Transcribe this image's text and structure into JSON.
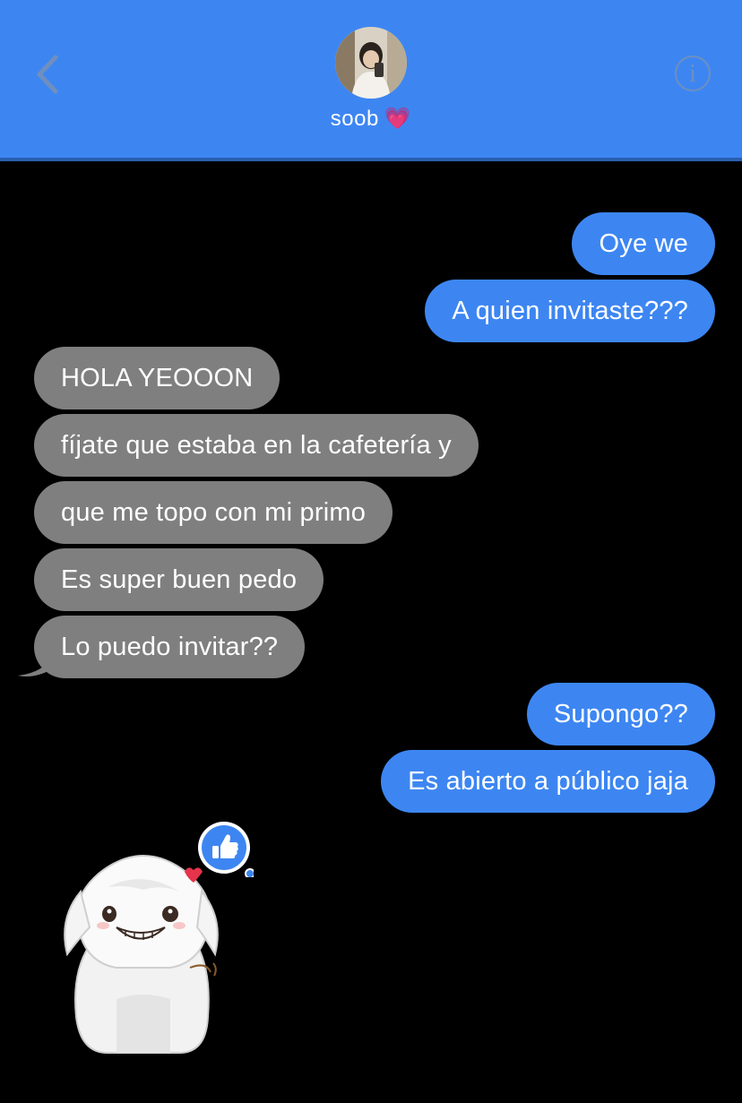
{
  "header": {
    "contact_name": "soob",
    "name_emoji": "💗",
    "info_glyph": "i",
    "back_icon": "chevron-left-icon",
    "info_icon": "info-icon"
  },
  "colors": {
    "header_bg": "#3d86f2",
    "outgoing_bubble": "#3d86f2",
    "incoming_bubble": "#7f7f7f",
    "background": "#000000"
  },
  "messages": [
    {
      "direction": "outgoing",
      "text": "Oye we"
    },
    {
      "direction": "outgoing",
      "text": "A quien invitaste???"
    },
    {
      "direction": "incoming",
      "text": "HOLA YEOOON"
    },
    {
      "direction": "incoming",
      "text": "fíjate que estaba en la cafetería y"
    },
    {
      "direction": "incoming",
      "text": "que me topo con mi primo"
    },
    {
      "direction": "incoming",
      "text": "Es super buen pedo"
    },
    {
      "direction": "incoming",
      "text": "Lo puedo invitar??"
    },
    {
      "direction": "outgoing",
      "text": "Supongo??"
    },
    {
      "direction": "outgoing",
      "text": "Es abierto a público jaja"
    }
  ],
  "sticker": {
    "icon": "white-dog-sticker-icon",
    "reaction": "thumbs-up-icon"
  }
}
